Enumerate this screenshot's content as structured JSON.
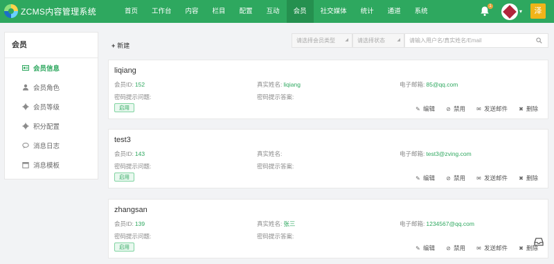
{
  "app": {
    "title": "ZCMS内容管理系统"
  },
  "nav": {
    "items": [
      "首页",
      "工作台",
      "内容",
      "栏目",
      "配置",
      "互动",
      "会员",
      "社交媒体",
      "统计",
      "通道",
      "系统"
    ],
    "active_index": 6
  },
  "header": {
    "notification_count": "1",
    "user_initial": "泽"
  },
  "sidebar": {
    "title": "会员",
    "items": [
      {
        "label": "会员信息",
        "icon": "id-card-icon",
        "active": true
      },
      {
        "label": "会员角色",
        "icon": "user-icon",
        "active": false
      },
      {
        "label": "会员等级",
        "icon": "gear-icon",
        "active": false
      },
      {
        "label": "积分配置",
        "icon": "gear-icon",
        "active": false
      },
      {
        "label": "消息日志",
        "icon": "chat-icon",
        "active": false
      },
      {
        "label": "消息模板",
        "icon": "calendar-icon",
        "active": false
      }
    ]
  },
  "toolbar": {
    "add_label": "新建",
    "member_type_placeholder": "请选择会员类型",
    "status_placeholder": "请选择状态",
    "search_placeholder": "请输入用户名/真实姓名/Email"
  },
  "labels": {
    "member_id": "会员ID:",
    "real_name": "真实姓名:",
    "email": "电子邮箱:",
    "pwd_question": "密码提示问题:",
    "pwd_answer": "密码提示答案:",
    "edit": "编辑",
    "disable": "禁用",
    "send_mail": "发送邮件",
    "delete": "删除"
  },
  "members": [
    {
      "username": "liqiang",
      "id": "152",
      "real_name": "liqiang",
      "email": "85@qq.com",
      "status": "启用"
    },
    {
      "username": "test3",
      "id": "143",
      "real_name": "",
      "email": "test3@zving.com",
      "status": "启用"
    },
    {
      "username": "zhangsan",
      "id": "139",
      "real_name": "张三",
      "email": "1234567@qq.com",
      "status": "启用"
    }
  ],
  "colors": {
    "brand": "#2ea85f",
    "nav_active": "#25904f",
    "user_chip": "#f0b419"
  }
}
